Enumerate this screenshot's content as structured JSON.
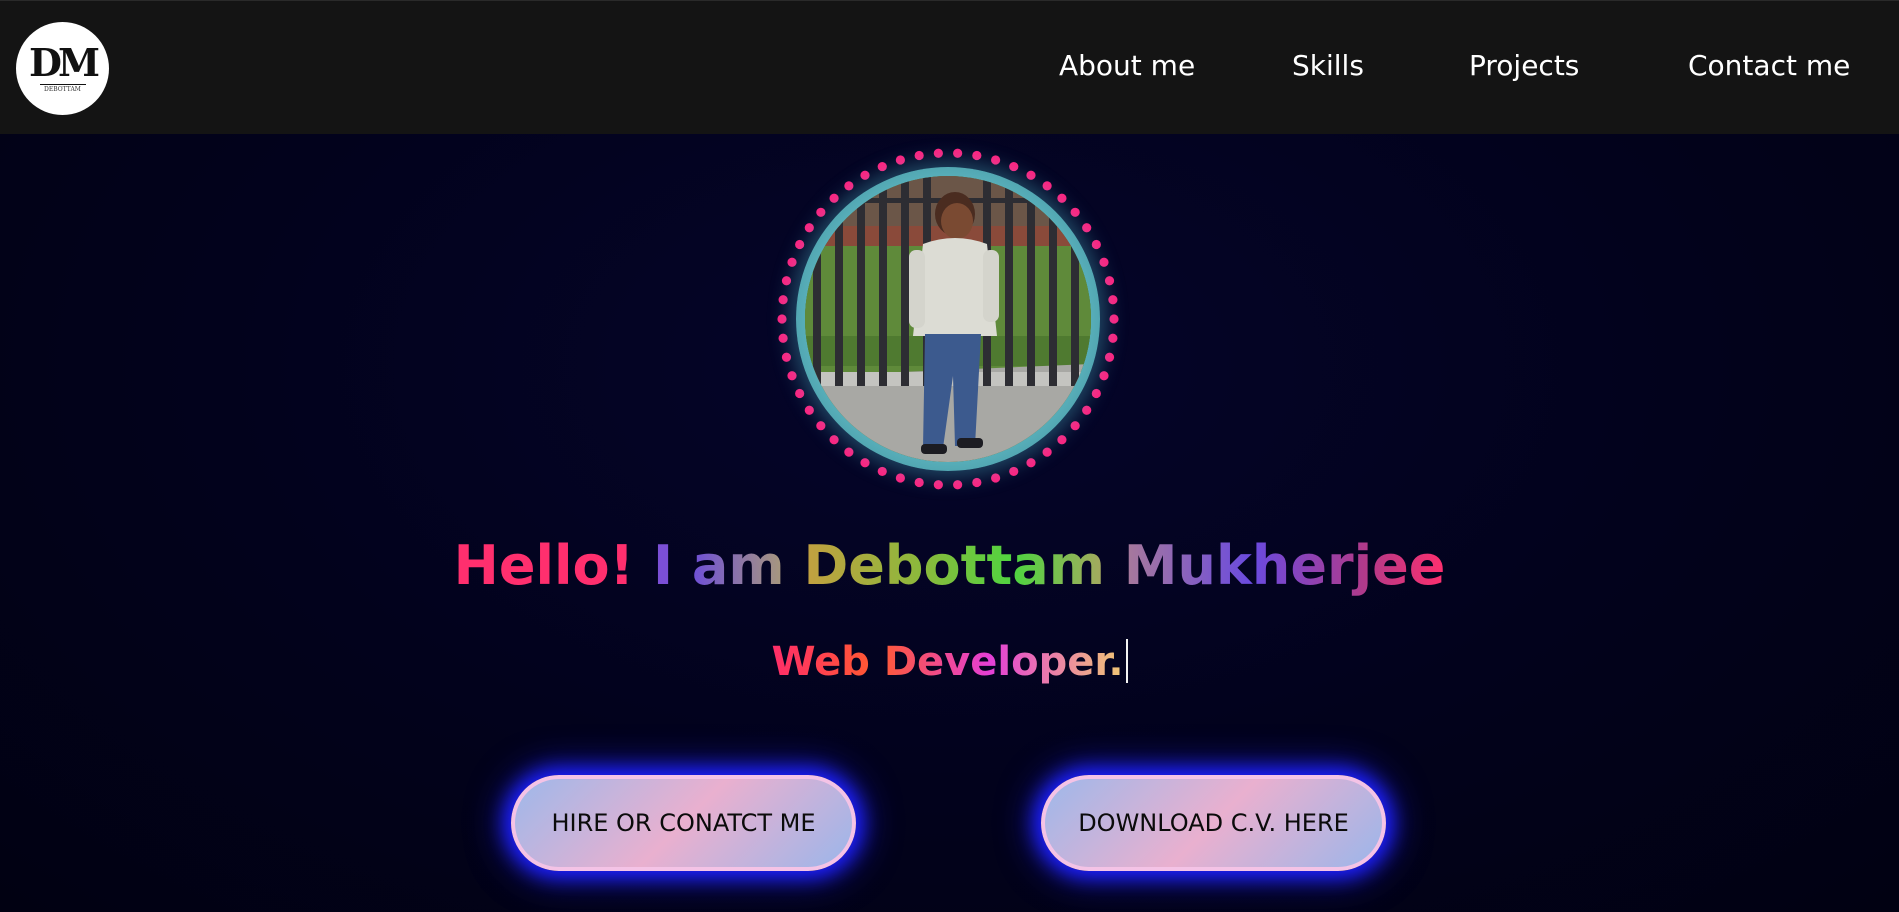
{
  "logo": {
    "monogram": "DM",
    "subtext": "DEBOTTAM"
  },
  "nav": {
    "items": [
      {
        "label": "About me"
      },
      {
        "label": "Skills"
      },
      {
        "label": "Projects"
      },
      {
        "label": "Contact me"
      }
    ]
  },
  "hero": {
    "greeting": {
      "words": [
        {
          "text": "Hello!",
          "color": "#ff2f6e"
        },
        {
          "text": "I",
          "color": "#7b4fd6"
        },
        {
          "text": "am",
          "color": "#7a5ed8"
        },
        {
          "text": "Debottam",
          "color": "#9fb040"
        },
        {
          "text": "Mukherjee",
          "color": "#9a6bd2"
        }
      ]
    },
    "typed_text": "Web Developer.",
    "buttons": {
      "hire_label": "HIRE OR CONATCT ME",
      "cv_label": "DOWNLOAD C.V. HERE"
    }
  },
  "colors": {
    "nav_bg": "#141414",
    "page_bg": "#02021c",
    "avatar_dots": "#ff1f7e",
    "avatar_ring": "#5fb7c2",
    "button_glow": "#1c1fff",
    "button_border": "#f4c3e6"
  }
}
